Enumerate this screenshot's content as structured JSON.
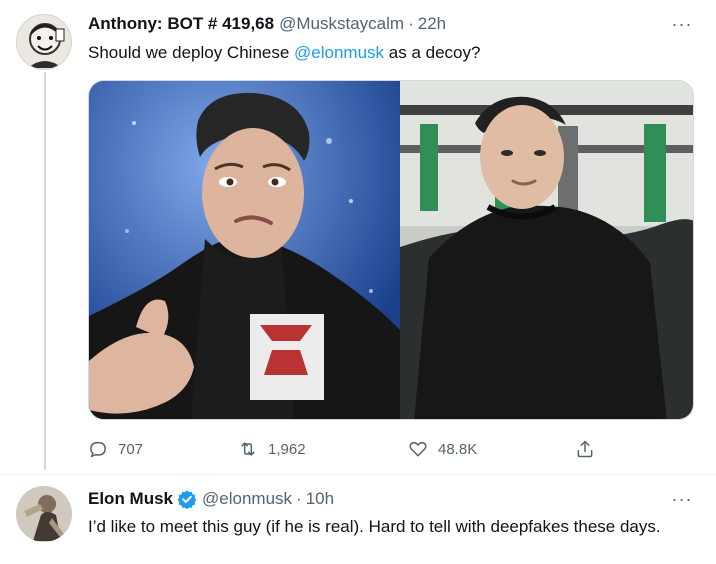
{
  "tweets": [
    {
      "author": {
        "name": "Anthony: BOT # 419,68",
        "handle": "@Muskstaycalm"
      },
      "separator": "·",
      "time": "22h",
      "more": "···",
      "text": {
        "prefix": "Should we deploy Chinese ",
        "mention": "@elonmusk",
        "suffix": " as a decoy?"
      },
      "media": [
        {
          "alt": "Elon Musk with a surprised expression wearing a black leather jacket"
        },
        {
          "alt": "A man resembling Elon Musk in a black puffer jacket in a parking garage"
        }
      ],
      "actions": {
        "reply": {
          "icon": "reply-icon",
          "count": "707"
        },
        "retweet": {
          "icon": "retweet-icon",
          "count": "1,962"
        },
        "like": {
          "icon": "heart-icon",
          "count": "48.8K"
        },
        "share": {
          "icon": "share-icon"
        }
      }
    },
    {
      "author": {
        "name": "Elon Musk",
        "handle": "@elonmusk",
        "verified": true
      },
      "separator": "·",
      "time": "10h",
      "more": "···",
      "text": "I’d like to meet this guy (if he is real). Hard to tell with deepfakes these days."
    }
  ],
  "colors": {
    "text": "#0f1419",
    "muted": "#536471",
    "accent": "#1d9bf0",
    "line": "#cfd9de"
  }
}
